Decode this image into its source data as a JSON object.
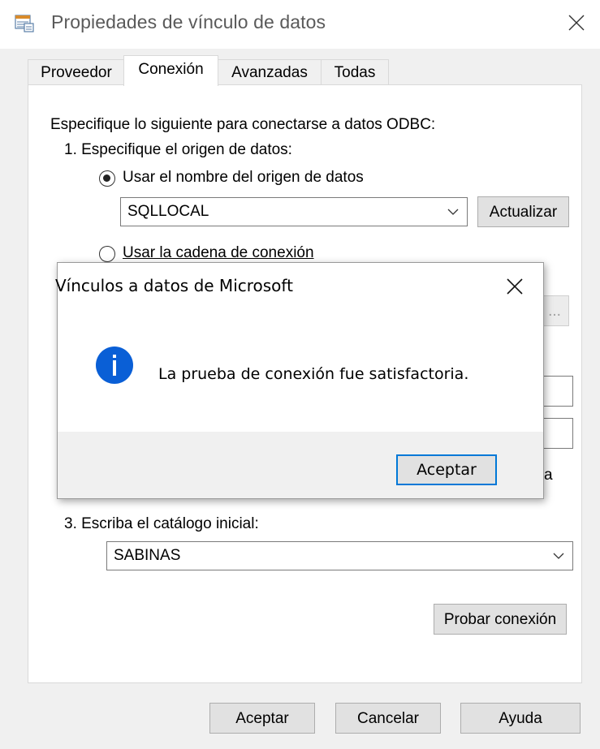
{
  "window": {
    "title": "Propiedades de vínculo de datos"
  },
  "tabs": [
    {
      "label": "Proveedor",
      "active": false
    },
    {
      "label": "Conexión",
      "active": true
    },
    {
      "label": "Avanzadas",
      "active": false
    },
    {
      "label": "Todas",
      "active": false
    }
  ],
  "connection": {
    "intro": "Especifique lo siguiente para conectarse a datos ODBC:",
    "step1_label": "1. Especifique el origen de datos:",
    "use_dsn_label": "Usar el nombre del origen de datos",
    "dsn_value": "SQLLOCAL",
    "refresh_label": "Actualizar",
    "use_connstring_label": "Usar la cadena de conexión",
    "partial_button_text": "...",
    "partial_text_right": "a",
    "step3_label": "3. Escriba el catálogo inicial:",
    "catalog_value": "SABINAS",
    "test_label": "Probar conexión"
  },
  "footer": {
    "ok_label": "Aceptar",
    "cancel_label": "Cancelar",
    "help_label": "Ayuda"
  },
  "dialog": {
    "title": "Vínculos a datos de Microsoft",
    "message": "La prueba de conexión fue satisfactoria.",
    "ok_label": "Aceptar",
    "icon": "info-icon"
  },
  "colors": {
    "accent": "#0078d7",
    "info_icon": "#0a5fd6",
    "window_bg": "#f0f0f0"
  }
}
